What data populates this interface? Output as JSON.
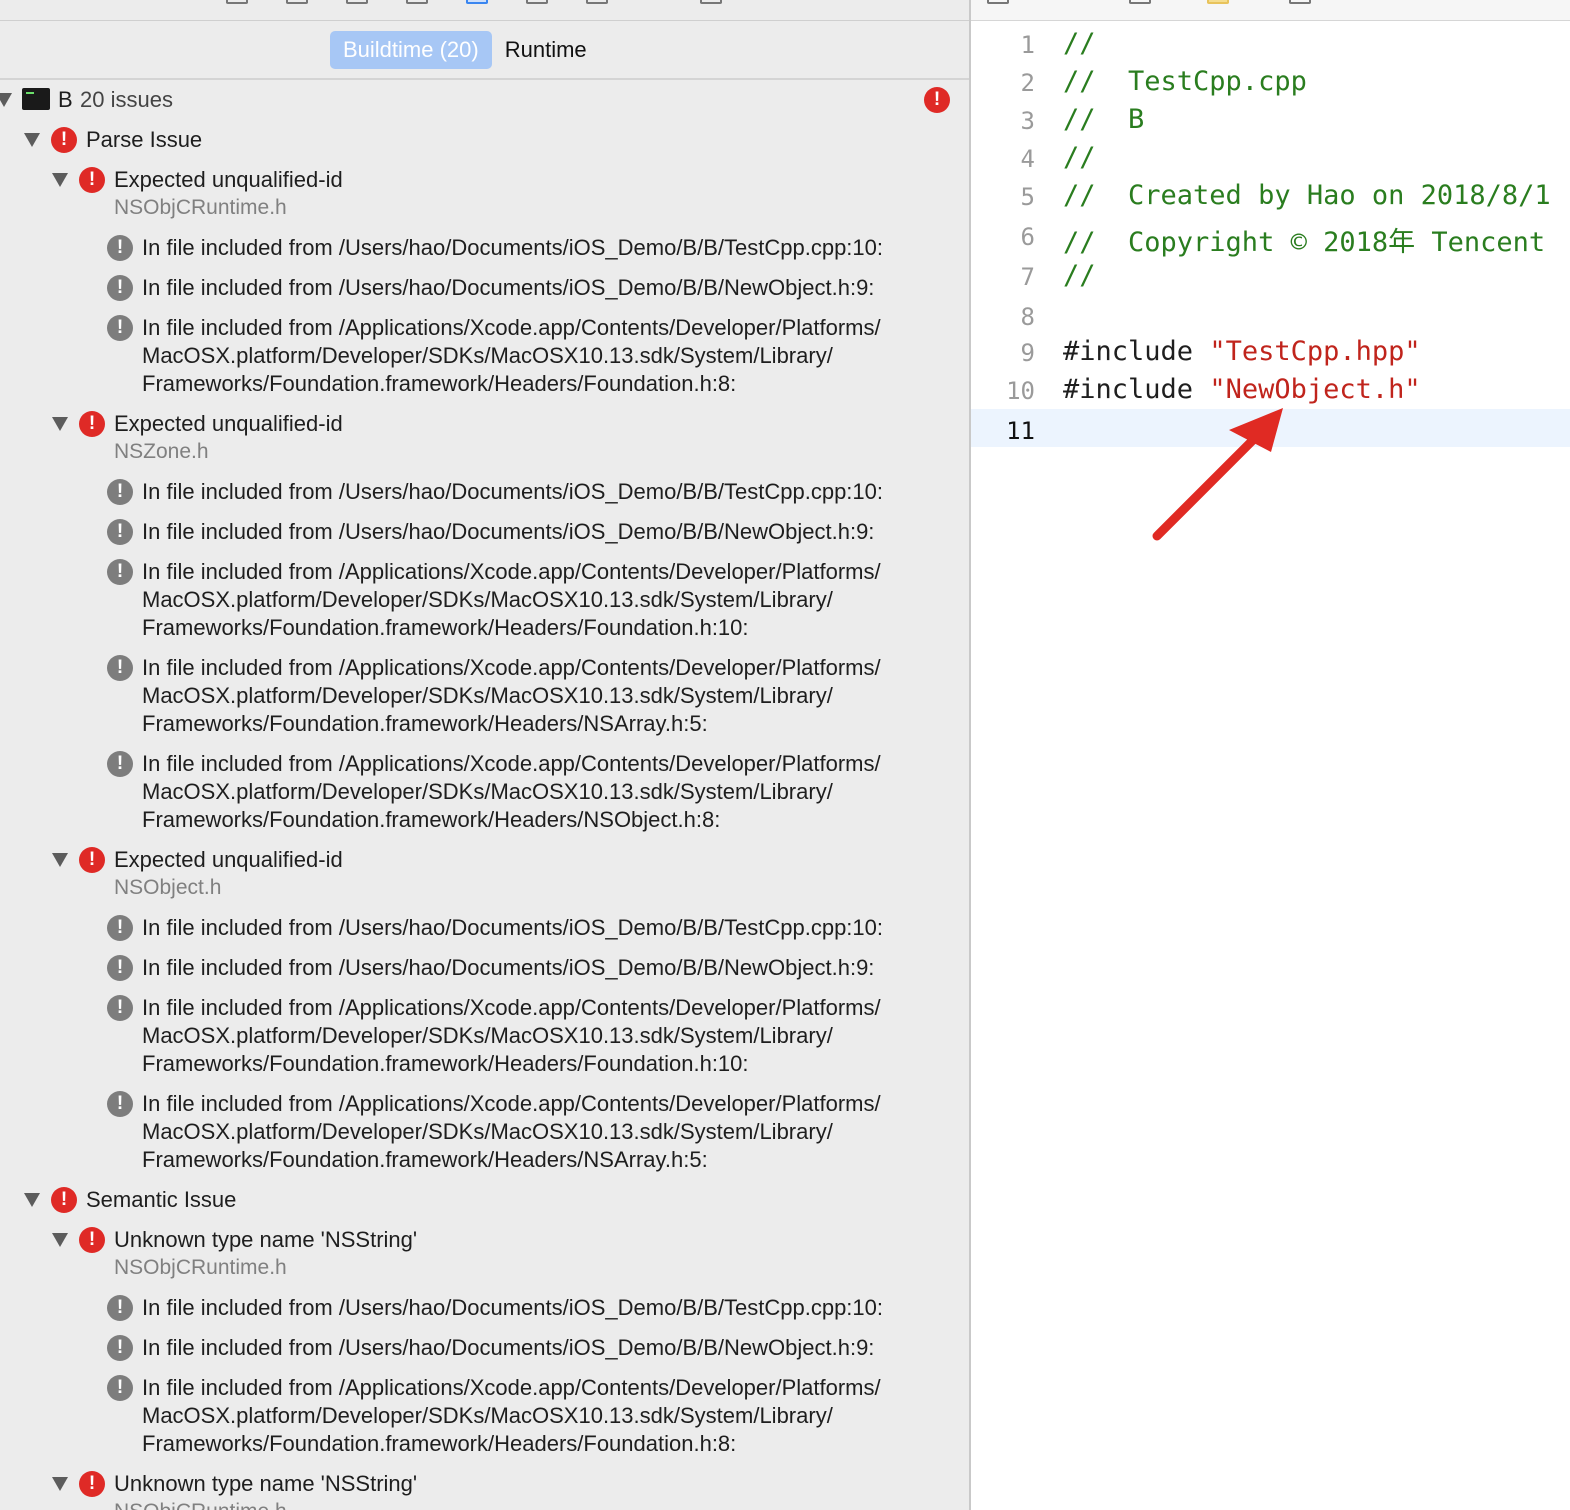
{
  "tabs": {
    "buildtime": "Buildtime (20)",
    "runtime": "Runtime"
  },
  "colors": {
    "error": "#df2a26",
    "note": "#7d7d7d",
    "comment": "#2a7d1f",
    "string": "#c0241c",
    "arrow": "#e02a23"
  },
  "project": {
    "name": "B",
    "issue_count": "20 issues"
  },
  "groups": [
    {
      "title": "Parse Issue",
      "issues": [
        {
          "title": "Expected unqualified-id",
          "file": "NSObjCRuntime.h",
          "notes": [
            "In file included from /Users/hao/Documents/iOS_Demo/B/B/TestCpp.cpp:10:",
            "In file included from /Users/hao/Documents/iOS_Demo/B/B/NewObject.h:9:",
            "In file included from /Applications/Xcode.app/Contents/Developer/Platforms/\nMacOSX.platform/Developer/SDKs/MacOSX10.13.sdk/System/Library/\nFrameworks/Foundation.framework/Headers/Foundation.h:8:"
          ]
        },
        {
          "title": "Expected unqualified-id",
          "file": "NSZone.h",
          "notes": [
            "In file included from /Users/hao/Documents/iOS_Demo/B/B/TestCpp.cpp:10:",
            "In file included from /Users/hao/Documents/iOS_Demo/B/B/NewObject.h:9:",
            "In file included from /Applications/Xcode.app/Contents/Developer/Platforms/\nMacOSX.platform/Developer/SDKs/MacOSX10.13.sdk/System/Library/\nFrameworks/Foundation.framework/Headers/Foundation.h:10:",
            "In file included from /Applications/Xcode.app/Contents/Developer/Platforms/\nMacOSX.platform/Developer/SDKs/MacOSX10.13.sdk/System/Library/\nFrameworks/Foundation.framework/Headers/NSArray.h:5:",
            "In file included from /Applications/Xcode.app/Contents/Developer/Platforms/\nMacOSX.platform/Developer/SDKs/MacOSX10.13.sdk/System/Library/\nFrameworks/Foundation.framework/Headers/NSObject.h:8:"
          ]
        },
        {
          "title": "Expected unqualified-id",
          "file": "NSObject.h",
          "notes": [
            "In file included from /Users/hao/Documents/iOS_Demo/B/B/TestCpp.cpp:10:",
            "In file included from /Users/hao/Documents/iOS_Demo/B/B/NewObject.h:9:",
            "In file included from /Applications/Xcode.app/Contents/Developer/Platforms/\nMacOSX.platform/Developer/SDKs/MacOSX10.13.sdk/System/Library/\nFrameworks/Foundation.framework/Headers/Foundation.h:10:",
            "In file included from /Applications/Xcode.app/Contents/Developer/Platforms/\nMacOSX.platform/Developer/SDKs/MacOSX10.13.sdk/System/Library/\nFrameworks/Foundation.framework/Headers/NSArray.h:5:"
          ]
        }
      ]
    },
    {
      "title": "Semantic Issue",
      "issues": [
        {
          "title": "Unknown type name 'NSString'",
          "file": "NSObjCRuntime.h",
          "notes": [
            "In file included from /Users/hao/Documents/iOS_Demo/B/B/TestCpp.cpp:10:",
            "In file included from /Users/hao/Documents/iOS_Demo/B/B/NewObject.h:9:",
            "In file included from /Applications/Xcode.app/Contents/Developer/Platforms/\nMacOSX.platform/Developer/SDKs/MacOSX10.13.sdk/System/Library/\nFrameworks/Foundation.framework/Headers/Foundation.h:8:"
          ]
        },
        {
          "title": "Unknown type name 'NSString'",
          "file": "NSObjCRuntime.h",
          "notes": []
        }
      ]
    }
  ],
  "editor": {
    "current_line": "11",
    "lines": [
      {
        "num": "1",
        "parts": [
          {
            "t": "//",
            "k": "comment"
          }
        ]
      },
      {
        "num": "2",
        "parts": [
          {
            "t": "//  TestCpp.cpp",
            "k": "comment"
          }
        ]
      },
      {
        "num": "3",
        "parts": [
          {
            "t": "//  B",
            "k": "comment"
          }
        ]
      },
      {
        "num": "4",
        "parts": [
          {
            "t": "//",
            "k": "comment"
          }
        ]
      },
      {
        "num": "5",
        "parts": [
          {
            "t": "//  Created by Hao on 2018/8/1",
            "k": "comment"
          }
        ]
      },
      {
        "num": "6",
        "parts": [
          {
            "t": "//  Copyright © 2018年 Tencent",
            "k": "comment"
          }
        ]
      },
      {
        "num": "7",
        "parts": [
          {
            "t": "//",
            "k": "comment"
          }
        ]
      },
      {
        "num": "8",
        "parts": []
      },
      {
        "num": "9",
        "parts": [
          {
            "t": "#include ",
            "k": "plain"
          },
          {
            "t": "\"TestCpp.hpp\"",
            "k": "str"
          }
        ]
      },
      {
        "num": "10",
        "parts": [
          {
            "t": "#include ",
            "k": "plain"
          },
          {
            "t": "\"NewObject.h\"",
            "k": "str"
          }
        ]
      },
      {
        "num": "11",
        "parts": []
      }
    ]
  }
}
